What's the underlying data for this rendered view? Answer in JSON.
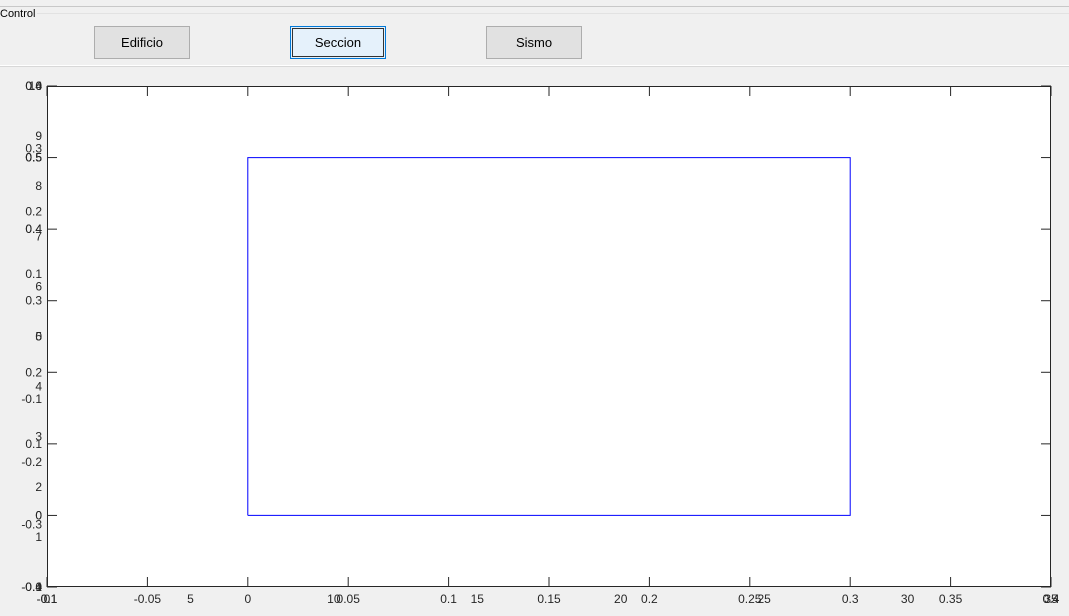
{
  "panel": {
    "title": "Control",
    "buttons": [
      {
        "label": "Edificio"
      },
      {
        "label": "Seccion"
      },
      {
        "label": "Sismo"
      }
    ]
  },
  "chart_data": {
    "type": "line",
    "title": "",
    "xlabel": "",
    "ylabel": "",
    "xlim": [
      -0.1,
      0.4
    ],
    "ylim": [
      -0.1,
      0.6
    ],
    "xticks": [
      "-0.1",
      "-0.05",
      "0",
      "0.05",
      "0.1",
      "0.15",
      "0.2",
      "0.25",
      "0.3",
      "0.35",
      "0.4"
    ],
    "yticks": [
      "-0.1",
      "0",
      "0.1",
      "0.2",
      "0.3",
      "0.4",
      "0.5",
      "0.6"
    ],
    "series": [
      {
        "color": "#0000ff",
        "x": [
          0,
          0.3,
          0.3,
          0,
          0
        ],
        "y": [
          0,
          0,
          0.5,
          0.5,
          0
        ]
      }
    ],
    "overlapping_axes": [
      {
        "xlim": [
          0,
          35
        ],
        "ylim": [
          0,
          10
        ],
        "xticks": [
          "0",
          "5",
          "10",
          "15",
          "20",
          "25",
          "30",
          "35"
        ],
        "yticks": [
          "0",
          "1",
          "2",
          "3",
          "4",
          "5",
          "6",
          "7",
          "8",
          "9",
          "10"
        ]
      },
      {
        "xlim": [
          -0.1,
          0.4
        ],
        "ylim": [
          -0.4,
          0.4
        ],
        "xticks": [
          "-0.1",
          "0.4"
        ],
        "yticks": [
          "-0.4",
          "-0.3",
          "-0.2",
          "-0.1",
          "0",
          "0.1",
          "0.2",
          "0.3",
          "0.4"
        ]
      },
      {
        "xlim": [
          -0.1,
          0.4
        ],
        "yticks": [
          "0",
          "0.5"
        ]
      },
      {
        "xlim": [
          -0.1,
          0.4
        ],
        "yticks": [
          "0.4",
          "0.5"
        ]
      }
    ],
    "grid": false,
    "box": true
  }
}
